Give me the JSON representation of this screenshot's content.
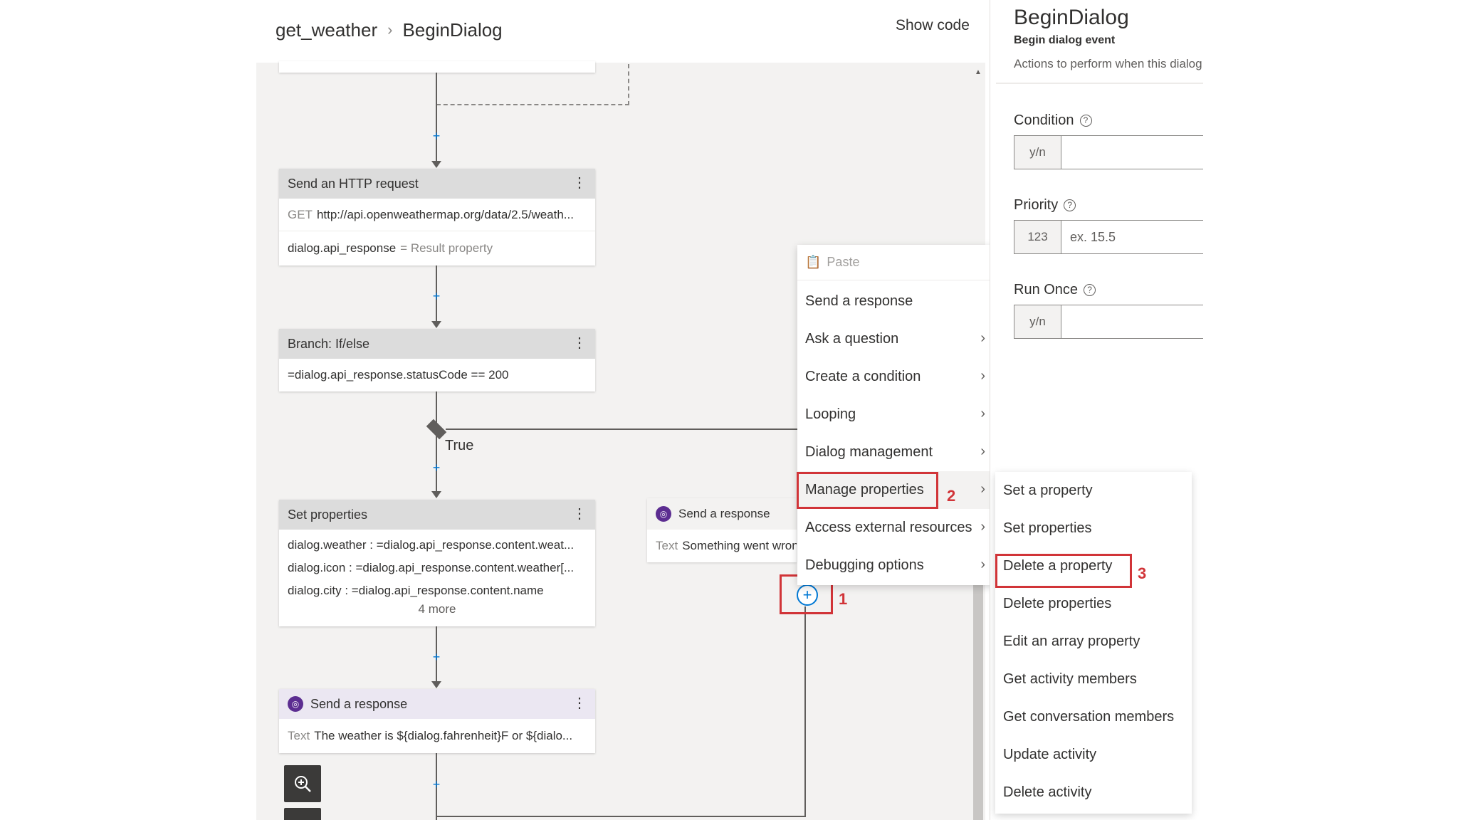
{
  "header": {
    "crumb_1": "get_weather",
    "crumb_2": "BeginDialog",
    "show_code": "Show code"
  },
  "flow": {
    "http_card": {
      "title": "Send an HTTP request",
      "method": "GET",
      "url": "http://api.openweathermap.org/data/2.5/weath...",
      "result_var": "dialog.api_response",
      "result_label": "= Result property"
    },
    "branch_card": {
      "title": "Branch: If/else",
      "condition": "=dialog.api_response.statusCode == 200"
    },
    "true_label": "True",
    "set_props_card": {
      "title": "Set properties",
      "rows": [
        "dialog.weather : =dialog.api_response.content.weat...",
        "dialog.icon : =dialog.api_response.content.weather[...",
        "dialog.city : =dialog.api_response.content.name"
      ],
      "more": "4 more"
    },
    "send_response_card": {
      "title": "Send a response",
      "text_label": "Text",
      "text": "The weather is ${dialog.fahrenheit}F or ${dialo..."
    },
    "false_card": {
      "title": "Send a response",
      "text_label": "Text",
      "text": "Something went wrong"
    }
  },
  "context_menu": {
    "paste": "Paste",
    "items": [
      {
        "label": "Send a response",
        "submenu": false
      },
      {
        "label": "Ask a question",
        "submenu": true
      },
      {
        "label": "Create a condition",
        "submenu": true
      },
      {
        "label": "Looping",
        "submenu": true
      },
      {
        "label": "Dialog management",
        "submenu": true
      },
      {
        "label": "Manage properties",
        "submenu": true
      },
      {
        "label": "Access external resources",
        "submenu": true
      },
      {
        "label": "Debugging options",
        "submenu": true
      }
    ]
  },
  "submenu": {
    "items": [
      "Set a property",
      "Set properties",
      "Delete a property",
      "Delete properties",
      "Edit an array property",
      "Get activity members",
      "Get conversation members",
      "Update activity",
      "Delete activity"
    ]
  },
  "annotations": {
    "step_1": "1",
    "step_2": "2",
    "step_3": "3",
    "color": "#d13438"
  },
  "panel": {
    "title": "BeginDialog",
    "subtitle": "Begin dialog event",
    "description": "Actions to perform when this dialog begins",
    "condition": {
      "label": "Condition",
      "prefix": "y/n",
      "value": ""
    },
    "priority": {
      "label": "Priority",
      "prefix": "123",
      "placeholder": "ex. 15.5"
    },
    "run_once": {
      "label": "Run Once",
      "prefix": "y/n",
      "value": ""
    }
  },
  "icons": {
    "paste": "clipboard-icon",
    "chevron": "chevron-right-icon",
    "help": "help-circle-icon",
    "zoom_in": "zoom-in-icon",
    "bot": "bot-icon"
  },
  "colors": {
    "accent": "#0078d4",
    "highlight": "#d13438",
    "bot": "#5c2d91"
  }
}
